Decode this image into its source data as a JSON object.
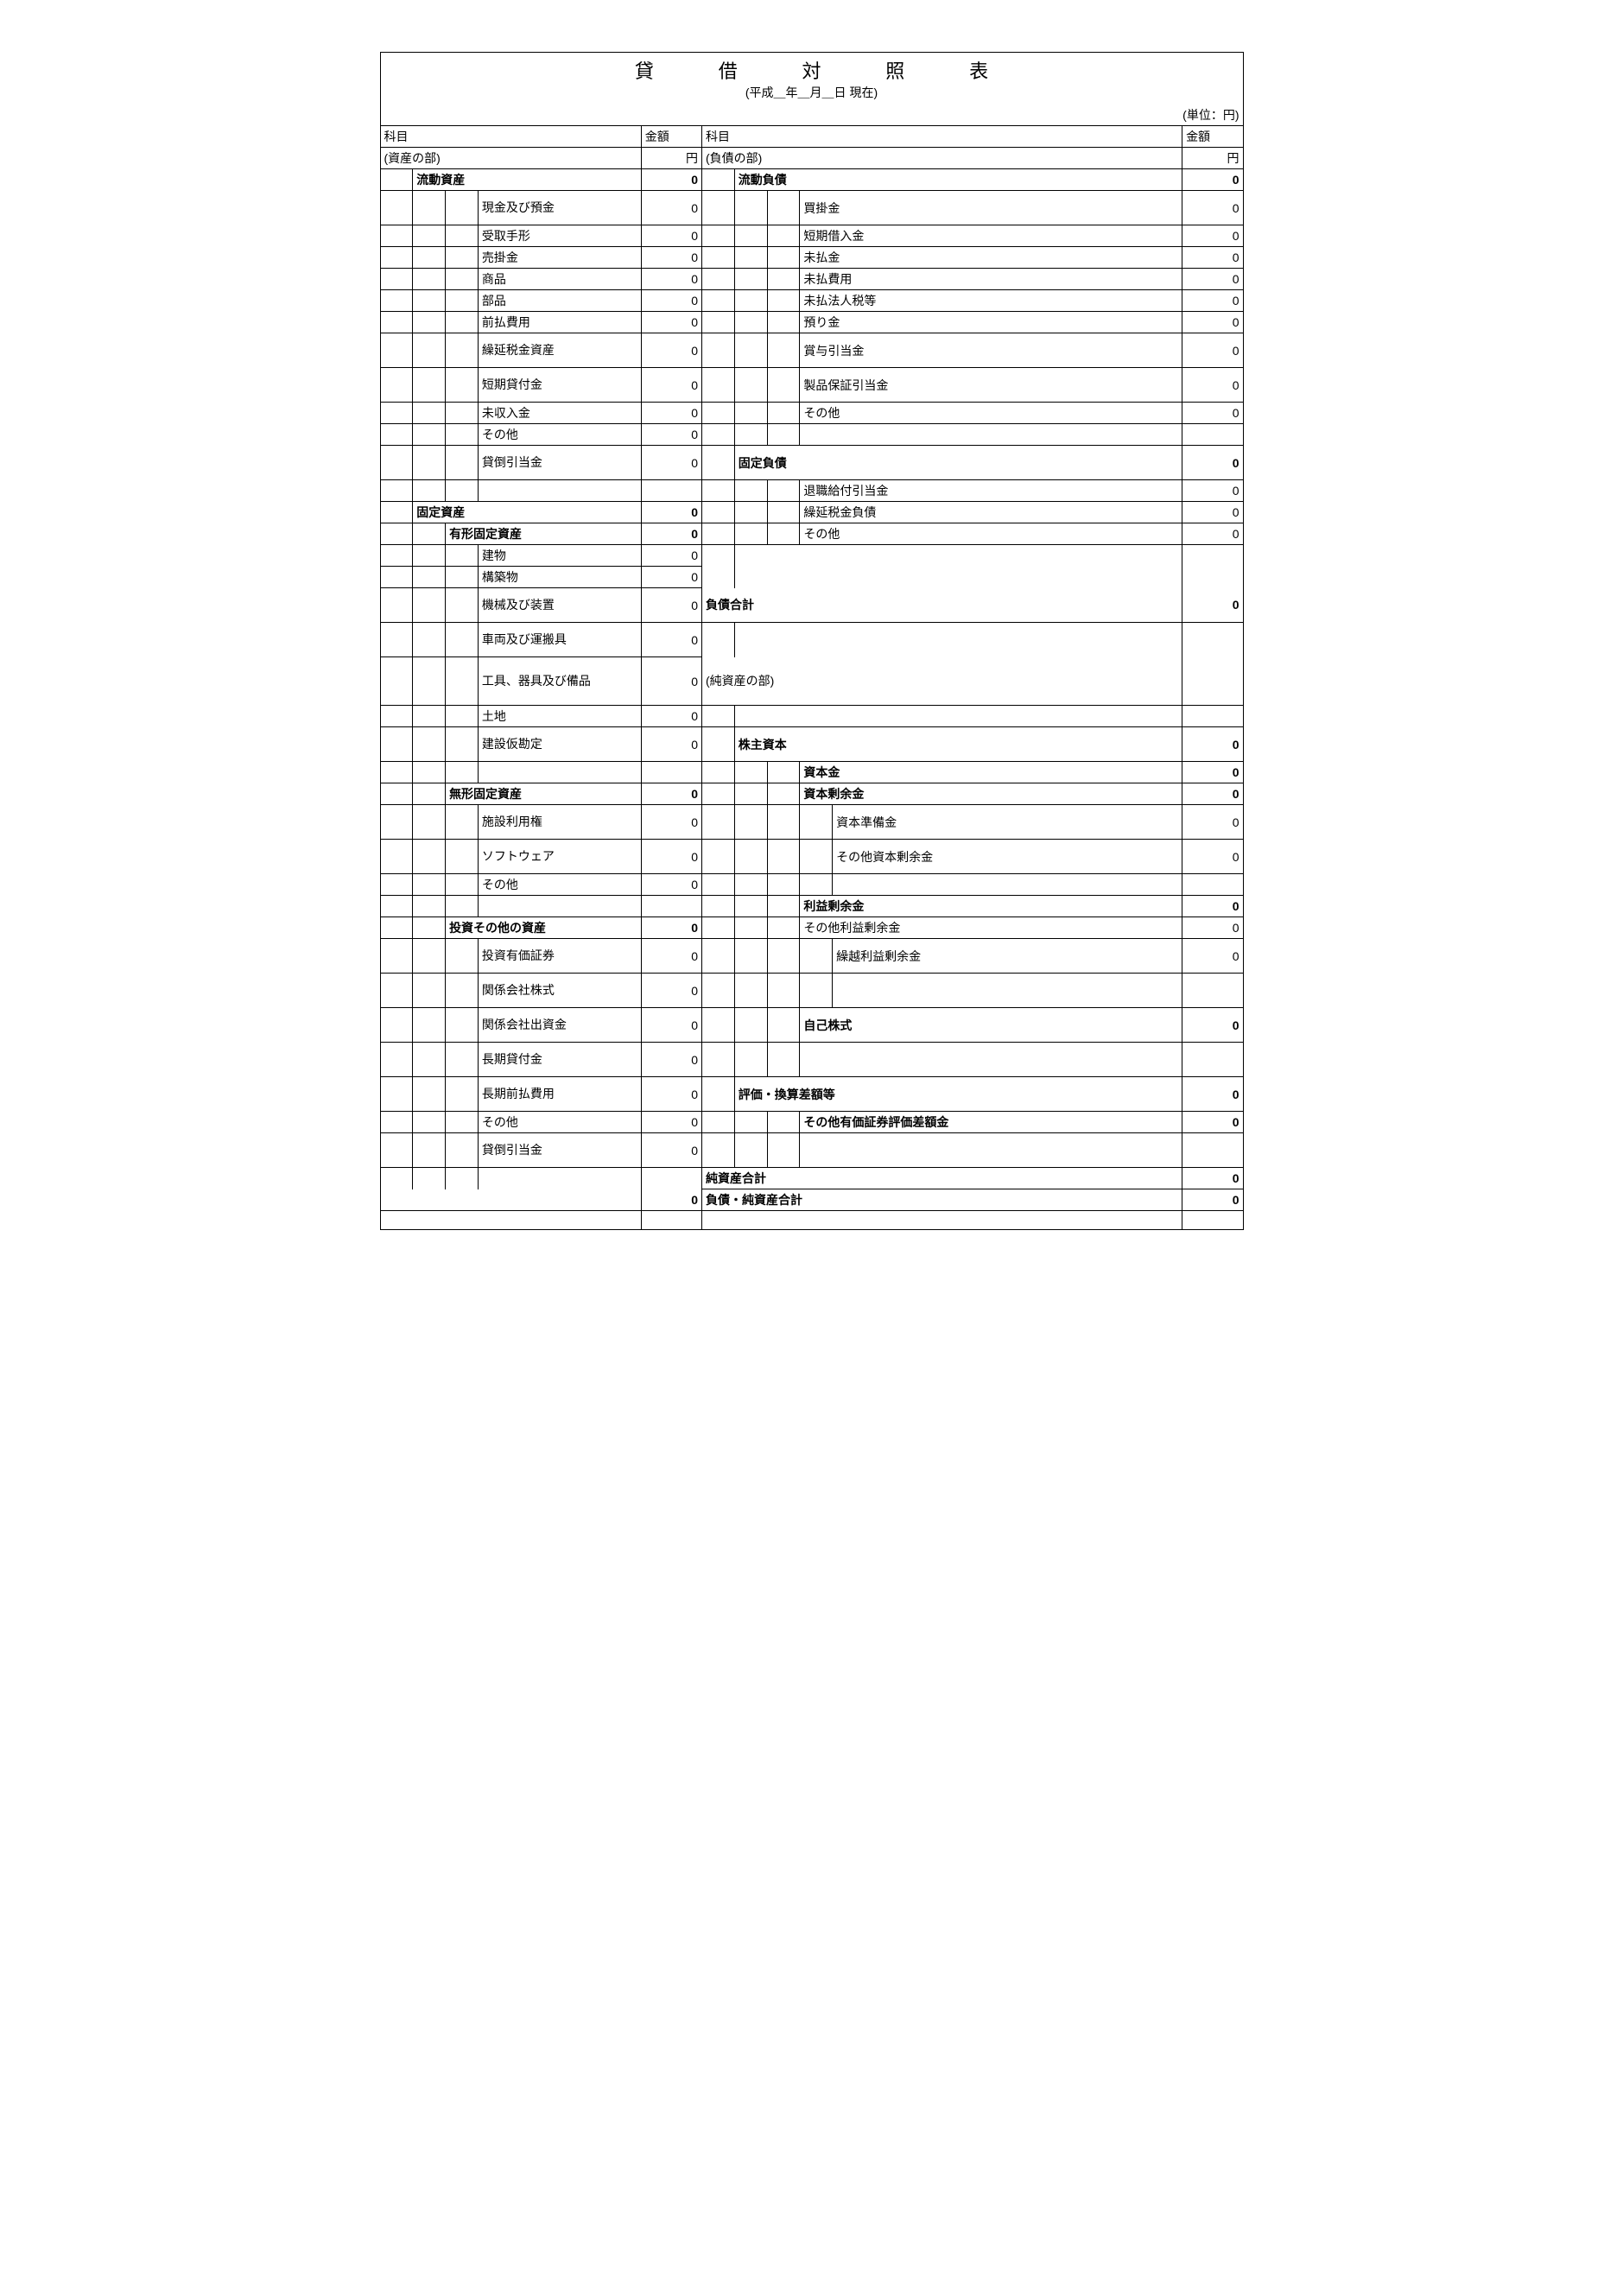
{
  "title": "貸　借　対　照　表",
  "subtitle": "(平成＿年＿月＿日 現在)",
  "unit": "(単位：円)",
  "headers": {
    "item": "科目",
    "amount": "金額"
  },
  "sections": {
    "assets": "(資産の部)",
    "liabilities": "(負債の部)",
    "net_assets": "(純資産の部)",
    "yen": "円"
  },
  "left": {
    "current_assets": "流動資産",
    "cash": "現金及び預金",
    "notes_recv": "受取手形",
    "ar": "売掛金",
    "goods": "商品",
    "parts": "部品",
    "prepaid": "前払費用",
    "deferred_tax_asset": "繰延税金資産",
    "short_loans": "短期貸付金",
    "accrued_income": "未収入金",
    "other1": "その他",
    "bad_debt": "貸倒引当金",
    "fixed_assets": "固定資産",
    "tangible": "有形固定資産",
    "buildings": "建物",
    "structures": "構築物",
    "machinery": "機械及び装置",
    "vehicles": "車両及び運搬具",
    "tools": "工具、器具及び備品",
    "land": "土地",
    "cip": "建設仮勘定",
    "intangible": "無形固定資産",
    "facility_rights": "施設利用権",
    "software": "ソフトウェア",
    "other2": "その他",
    "investments": "投資その他の資産",
    "securities": "投資有価証券",
    "affiliate_stock": "関係会社株式",
    "affiliate_invest": "関係会社出資金",
    "long_loans": "長期貸付金",
    "long_prepaid": "長期前払費用",
    "other3": "その他",
    "bad_debt2": "貸倒引当金"
  },
  "right": {
    "current_liab": "流動負債",
    "ap": "買掛金",
    "short_debt": "短期借入金",
    "accrued_pay": "未払金",
    "accrued_exp": "未払費用",
    "tax_payable": "未払法人税等",
    "deposits": "預り金",
    "bonus_allow": "賞与引当金",
    "warranty": "製品保証引当金",
    "other_cl": "その他",
    "fixed_liab": "固定負債",
    "retirement": "退職給付引当金",
    "deferred_tax_liab": "繰延税金負債",
    "other_fl": "その他",
    "total_liab": "負債合計",
    "shareholders": "株主資本",
    "capital": "資本金",
    "capital_surplus": "資本剰余金",
    "capital_reserve": "資本準備金",
    "other_cap_surplus": "その他資本剰余金",
    "retained": "利益剰余金",
    "other_retained": "その他利益剰余金",
    "carried_profit": "繰越利益剰余金",
    "treasury": "自己株式",
    "valuation": "評価・換算差額等",
    "sec_valuation": "その他有価証券評価差額金",
    "total_na": "純資産合計",
    "total_liab_na": "負債・純資産合計"
  },
  "val": {
    "zero": "0"
  }
}
